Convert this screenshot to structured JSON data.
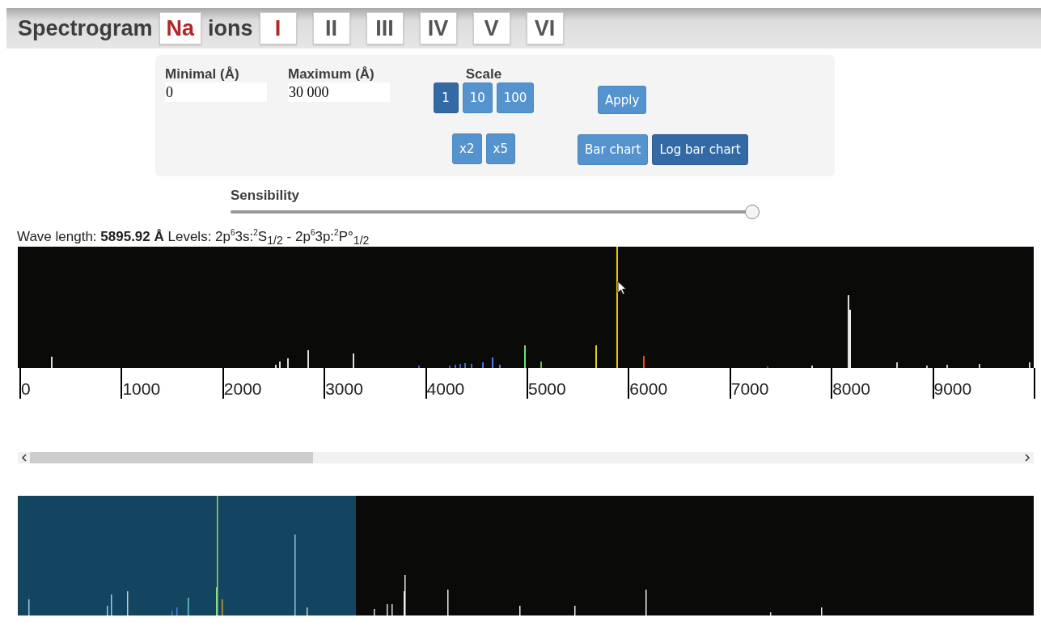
{
  "header": {
    "title": "Spectrogram",
    "element": "Na",
    "ions_label": "ions",
    "ions": [
      {
        "label": "I",
        "selected": true
      },
      {
        "label": "II",
        "selected": false
      },
      {
        "label": "III",
        "selected": false
      },
      {
        "label": "IV",
        "selected": false
      },
      {
        "label": "V",
        "selected": false
      },
      {
        "label": "VI",
        "selected": false
      }
    ]
  },
  "controls": {
    "minimal": {
      "label": "Minimal (Å)",
      "value": "0"
    },
    "maximum": {
      "label": "Maximum (Å)",
      "value": "30 000"
    },
    "scale": {
      "label": "Scale",
      "options": [
        {
          "label": "1",
          "selected": true
        },
        {
          "label": "10",
          "selected": false
        },
        {
          "label": "100",
          "selected": false
        }
      ]
    },
    "zoom": [
      "x2",
      "x5"
    ],
    "apply": "Apply",
    "chart_types": [
      {
        "label": "Bar chart",
        "selected": false
      },
      {
        "label": "Log bar chart",
        "selected": true
      }
    ]
  },
  "sensibility": {
    "label": "Sensibility",
    "level": 1
  },
  "wave_info": "Wave length: **5895.92 Å** Levels: 2p$^{6}$3s:$^{2}$S$_{1/2}$ - 2p$^{6}$3p:$^{2}$P°$_{1/2}$",
  "axis_labels": [
    "0",
    "1000",
    "2000",
    "3000",
    "4000",
    "5000",
    "6000",
    "7000",
    "8000",
    "9000"
  ]
}
